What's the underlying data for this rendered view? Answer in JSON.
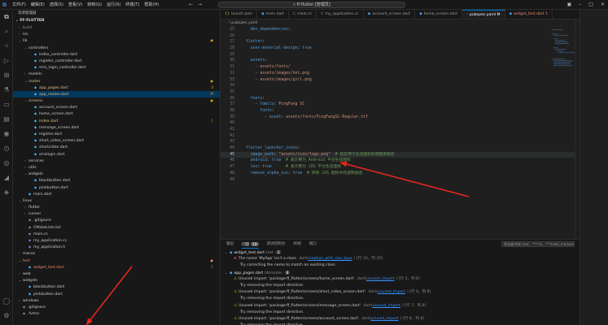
{
  "titlebar": {
    "menu": [
      "文件(F)",
      "编辑(E)",
      "选择(S)",
      "查看(V)",
      "转到(G)",
      "运行(R)",
      "终端(T)",
      "帮助(H)"
    ],
    "search": "ff-flutter [管理员]",
    "nav_back": "←",
    "nav_forward": "→"
  },
  "sidebar": {
    "title": "资源管理器",
    "project": "FF-FLUTTER",
    "rows": [
      {
        "indent": 1,
        "chev": "›",
        "label": "build",
        "type": "dir",
        "color": "c-dim"
      },
      {
        "indent": 1,
        "chev": "›",
        "label": "ios",
        "type": "dir",
        "color": "c-dir"
      },
      {
        "indent": 1,
        "chev": "⌄",
        "label": "lib",
        "type": "dir",
        "color": "c-mod",
        "badge": "●"
      },
      {
        "indent": 2,
        "chev": "⌄",
        "label": "controllers",
        "type": "dir",
        "color": "c-dir"
      },
      {
        "indent": 3,
        "chev": "",
        "label": "index_controller.dart",
        "type": "file",
        "color": "c-file"
      },
      {
        "indent": 3,
        "chev": "",
        "label": "register_controller.dart",
        "type": "file",
        "color": "c-file"
      },
      {
        "indent": 3,
        "chev": "",
        "label": "sms_login_controller.dart",
        "type": "file",
        "color": "c-file"
      },
      {
        "indent": 2,
        "chev": "›",
        "label": "models",
        "type": "dir",
        "color": "c-dir"
      },
      {
        "indent": 2,
        "chev": "⌄",
        "label": "routes",
        "type": "dir",
        "color": "c-mod",
        "badge": "●"
      },
      {
        "indent": 3,
        "chev": "",
        "label": "app_pages.dart",
        "type": "file",
        "color": "c-mod",
        "badge": "4"
      },
      {
        "indent": 3,
        "chev": "",
        "label": "app_routes.dart",
        "type": "file",
        "color": "c-mod",
        "badge": "M",
        "sel": true
      },
      {
        "indent": 2,
        "chev": "⌄",
        "label": "screens",
        "type": "dir",
        "color": "c-mod",
        "badge": "●"
      },
      {
        "indent": 3,
        "chev": "",
        "label": "account_screen.dart",
        "type": "file",
        "color": "c-file"
      },
      {
        "indent": 3,
        "chev": "",
        "label": "home_screen.dart",
        "type": "file",
        "color": "c-file"
      },
      {
        "indent": 3,
        "chev": "",
        "label": "index.dart",
        "type": "file",
        "color": "c-mod",
        "badge": "1"
      },
      {
        "indent": 3,
        "chev": "",
        "label": "message_screen.dart",
        "type": "file",
        "color": "c-file"
      },
      {
        "indent": 3,
        "chev": "",
        "label": "register.dart",
        "type": "file",
        "color": "c-file"
      },
      {
        "indent": 3,
        "chev": "",
        "label": "short_video_screen.dart",
        "type": "file",
        "color": "c-file"
      },
      {
        "indent": 3,
        "chev": "",
        "label": "shortvideo.dart",
        "type": "file",
        "color": "c-file"
      },
      {
        "indent": 3,
        "chev": "",
        "label": "smslogin.dart",
        "type": "file",
        "color": "c-file"
      },
      {
        "indent": 2,
        "chev": "›",
        "label": "services",
        "type": "dir",
        "color": "c-dir"
      },
      {
        "indent": 2,
        "chev": "›",
        "label": "utils",
        "type": "dir",
        "color": "c-dir"
      },
      {
        "indent": 2,
        "chev": "⌄",
        "label": "widgets",
        "type": "dir",
        "color": "c-dir"
      },
      {
        "indent": 3,
        "chev": "",
        "label": "blackbutton.dart",
        "type": "file",
        "color": "c-file"
      },
      {
        "indent": 3,
        "chev": "",
        "label": "pinkbutton.dart",
        "type": "file",
        "color": "c-file"
      },
      {
        "indent": 2,
        "chev": "",
        "label": "main.dart",
        "type": "file",
        "color": "c-file"
      },
      {
        "indent": 1,
        "chev": "⌄",
        "label": "linux",
        "type": "dir",
        "color": "c-dir"
      },
      {
        "indent": 2,
        "chev": "›",
        "label": "flutter",
        "type": "dir",
        "color": "c-dir"
      },
      {
        "indent": 2,
        "chev": "›",
        "label": "runner",
        "type": "dir",
        "color": "c-dir"
      },
      {
        "indent": 2,
        "chev": "",
        "label": ".gitignore",
        "type": "file",
        "color": "c-file"
      },
      {
        "indent": 2,
        "chev": "",
        "label": "CMakeLists.txt",
        "type": "file",
        "color": "c-file"
      },
      {
        "indent": 2,
        "chev": "",
        "label": "main.cc",
        "type": "file",
        "color": "c-file"
      },
      {
        "indent": 2,
        "chev": "",
        "label": "my_application.cc",
        "type": "file",
        "color": "c-file"
      },
      {
        "indent": 2,
        "chev": "",
        "label": "my_application.h",
        "type": "file",
        "color": "c-file"
      },
      {
        "indent": 1,
        "chev": "›",
        "label": "macos",
        "type": "dir",
        "color": "c-dir"
      },
      {
        "indent": 1,
        "chev": "⌄",
        "label": "test",
        "type": "dir",
        "color": "c-err",
        "badge": "●"
      },
      {
        "indent": 2,
        "chev": "",
        "label": "widget_test.dart",
        "type": "file",
        "color": "c-err",
        "badge": "1"
      },
      {
        "indent": 1,
        "chev": "›",
        "label": "web",
        "type": "dir",
        "color": "c-dir"
      },
      {
        "indent": 1,
        "chev": "⌄",
        "label": "widgets",
        "type": "dir",
        "color": "c-dir"
      },
      {
        "indent": 2,
        "chev": "",
        "label": "blackbutton.dart",
        "type": "file",
        "color": "c-file"
      },
      {
        "indent": 2,
        "chev": "",
        "label": "pinkbutton.dart",
        "type": "file",
        "color": "c-file"
      },
      {
        "indent": 1,
        "chev": "›",
        "label": "windows",
        "type": "dir",
        "color": "c-dir"
      },
      {
        "indent": 1,
        "chev": "",
        "label": ".gitignore",
        "type": "file",
        "color": "c-file"
      },
      {
        "indent": 1,
        "chev": "",
        "label": ".fvmrc",
        "type": "file",
        "color": "c-file"
      }
    ]
  },
  "tabs": [
    {
      "label": "launch.json",
      "icon": "{}"
    },
    {
      "label": "main.dart",
      "icon": "◆"
    },
    {
      "label": "main.cc",
      "icon": "C"
    },
    {
      "label": "my_application.cc",
      "icon": "C"
    },
    {
      "label": "account_screen.dart",
      "icon": "◆"
    },
    {
      "label": "home_screen.dart",
      "icon": "◆"
    },
    {
      "label": "pubspec.yaml M",
      "icon": "!",
      "active": true
    },
    {
      "label": "widget_test.dart 1",
      "icon": "◆",
      "err": true
    }
  ],
  "breadcrumb": "! pubspec.yaml",
  "code": [
    {
      "n": "25",
      "t": "  dev_dependencies:"
    },
    {
      "n": "26",
      "t": ""
    },
    {
      "n": "27",
      "t": "flutter:"
    },
    {
      "n": "28",
      "t": "  uses-material-design: true"
    },
    {
      "n": "29",
      "t": ""
    },
    {
      "n": "30",
      "t": "  assets:"
    },
    {
      "n": "31",
      "t": "    - assets/fonts/"
    },
    {
      "n": "32",
      "t": "    - assets/images/hot.png"
    },
    {
      "n": "33",
      "t": "    - assets/images/girl.png"
    },
    {
      "n": "34",
      "t": ""
    },
    {
      "n": "35",
      "t": ""
    },
    {
      "n": "36",
      "t": "  fonts:"
    },
    {
      "n": "37",
      "t": "    - family: PingFang SC"
    },
    {
      "n": "38",
      "t": "      fonts:"
    },
    {
      "n": "39",
      "t": "        - asset: assets/fonts/PingFangSC-Regular.ttf"
    },
    {
      "n": "40",
      "t": ""
    },
    {
      "n": "41",
      "t": ""
    },
    {
      "n": "42",
      "t": ""
    },
    {
      "n": "43",
      "t": ""
    },
    {
      "n": "44",
      "t": "flutter_launcher_icons:"
    },
    {
      "n": "45",
      "t": "  image_path: \"assets/icon/logo.png\"  # 指定用于生成图标的源图像路径",
      "hl": true
    },
    {
      "n": "46",
      "t": "  android: true  # 表示要为 Android 平台生成图标"
    },
    {
      "n": "47",
      "t": "  ios: true      # 表示要为 iOS 平台生成图标"
    },
    {
      "n": "48",
      "t": "  remove_alpha_ios: true  # 移除 iOS 图标中的透明通道"
    },
    {
      "n": "49",
      "t": ""
    }
  ],
  "panel": {
    "tabs": [
      "输出",
      "问题",
      "调试控制台",
      "终端",
      "端口"
    ],
    "problem_count": "10",
    "filter_placeholder": "筛选器(例如 text、**/*.ts、!**/node_modules/**)",
    "rows": [
      {
        "kind": "file",
        "file": "widget_test.dart",
        "dir": "test",
        "count": "1"
      },
      {
        "kind": "msg",
        "sev": "e",
        "text": "The name 'MyApp' isn't a class.",
        "src": "dart(",
        "link": "creation_with_non_type",
        "pos": ") [行 16，列 35]"
      },
      {
        "kind": "hint",
        "text": "Try correcting the name to match an existing class."
      },
      {
        "kind": "file",
        "file": "app_pages.dart",
        "dir": "lib\\routes",
        "count": "4"
      },
      {
        "kind": "msg",
        "sev": "w",
        "text": "Unused import: 'package:ff_flutter/screens/home_screen.dart'.",
        "src": "dart(",
        "link": "unused_import",
        "pos": ") [行 5，列 8]"
      },
      {
        "kind": "hint",
        "text": "Try removing the import directive."
      },
      {
        "kind": "msg",
        "sev": "w",
        "text": "Unused import: 'package:ff_flutter/screens/short_video_screen.dart'.",
        "src": "dart(",
        "link": "unused_import",
        "pos": ") [行 6，列 8]"
      },
      {
        "kind": "hint",
        "text": "Try removing the import directive."
      },
      {
        "kind": "msg",
        "sev": "w",
        "text": "Unused import: 'package:ff_flutter/screens/message_screen.dart'.",
        "src": "dart(",
        "link": "unused_import",
        "pos": ") [行 7，列 8]"
      },
      {
        "kind": "hint",
        "text": "Try removing the import directive."
      },
      {
        "kind": "msg",
        "sev": "w",
        "text": "Unused import: 'package:ff_flutter/screens/account_screen.dart'.",
        "src": "dart(",
        "link": "unused_import",
        "pos": ") [行 8，列 8]"
      },
      {
        "kind": "hint",
        "text": "Try removing the import directive."
      }
    ]
  },
  "colors": {
    "accent": "#0078d4",
    "annotation_arrow": "#e8261f",
    "error": "#f14c4c",
    "warning": "#cca700",
    "modified": "#e2c08d"
  }
}
